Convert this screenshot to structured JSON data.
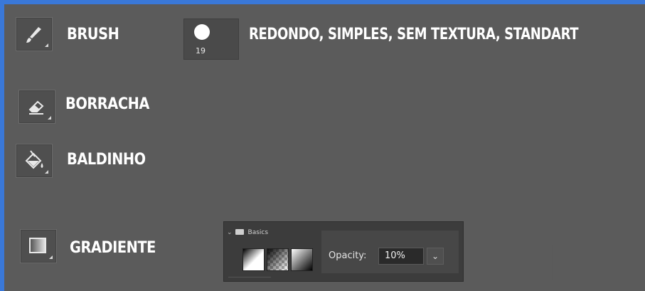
{
  "tools": [
    {
      "name": "brush",
      "label": "BRUSH",
      "icon": "brush-icon"
    },
    {
      "name": "eraser",
      "label": "BORRACHA",
      "icon": "eraser-icon"
    },
    {
      "name": "bucket",
      "label": "BALDINHO",
      "icon": "paint-bucket-icon"
    },
    {
      "name": "gradient",
      "label": "GRADIENTE",
      "icon": "gradient-icon"
    }
  ],
  "brush": {
    "size": "19",
    "description": "REDONDO, SIMPLES, SEM TEXTURA, STANDART"
  },
  "gradient_panel": {
    "folder_label": "Basics",
    "opacity_label": "Opacity:",
    "opacity_value": "10%"
  },
  "colors": {
    "background": "#5b5b5b",
    "frame": "#3a78d8",
    "text": "#ffffff"
  }
}
